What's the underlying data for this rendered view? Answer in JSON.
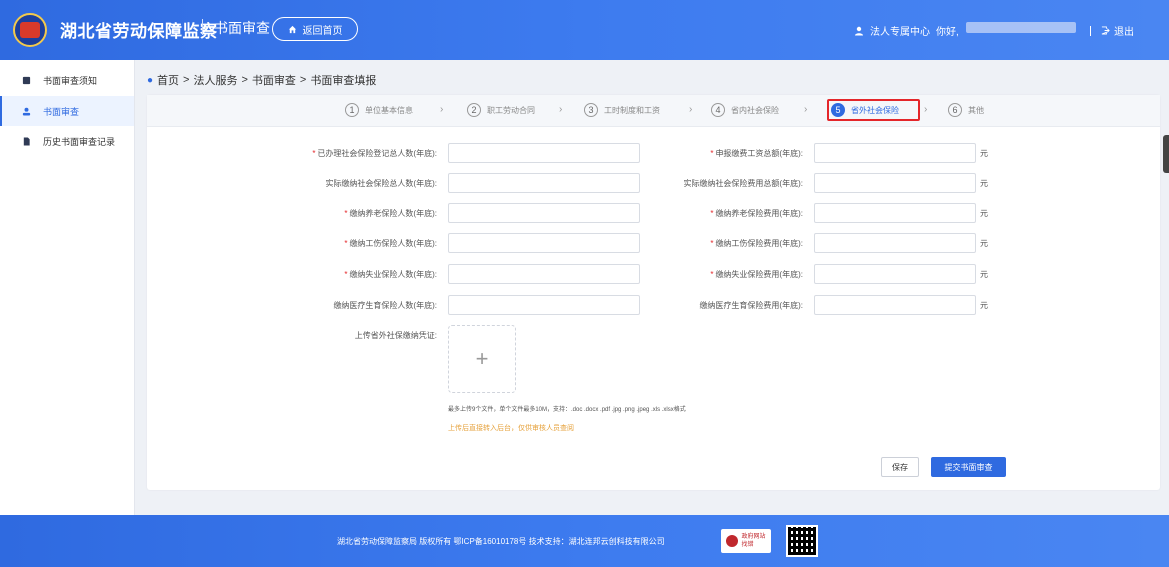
{
  "header": {
    "site_title": "湖北省劳动保障监察",
    "sub_title": "书面审查",
    "home_button": "返回首页",
    "user_center": "法人专属中心",
    "greeting": "你好,",
    "logout": "退出"
  },
  "sidebar": {
    "items": [
      {
        "label": "书面审查须知"
      },
      {
        "label": "书面审查"
      },
      {
        "label": "历史书面审查记录"
      }
    ]
  },
  "breadcrumb": [
    "首页",
    "法人服务",
    "书面审查",
    "书面审查填报"
  ],
  "breadcrumb_sep": ">",
  "steps": [
    {
      "num": "1",
      "label": "单位基本信息"
    },
    {
      "num": "2",
      "label": "职工劳动合同"
    },
    {
      "num": "3",
      "label": "工时制度和工资"
    },
    {
      "num": "4",
      "label": "省内社会保险"
    },
    {
      "num": "5",
      "label": "省外社会保险"
    },
    {
      "num": "6",
      "label": "其他"
    }
  ],
  "active_step": 5,
  "form": {
    "left": [
      {
        "label": "已办理社会保险登记总人数(年底):",
        "required": true,
        "value": ""
      },
      {
        "label": "实际缴纳社会保险总人数(年底):",
        "required": false,
        "value": ""
      },
      {
        "label": "缴纳养老保险人数(年底):",
        "required": true,
        "value": ""
      },
      {
        "label": "缴纳工伤保险人数(年底):",
        "required": true,
        "value": ""
      },
      {
        "label": "缴纳失业保险人数(年底):",
        "required": true,
        "value": ""
      },
      {
        "label": "缴纳医疗生育保险人数(年底):",
        "required": false,
        "value": ""
      }
    ],
    "right": [
      {
        "label": "申报缴费工资总额(年底):",
        "required": true,
        "value": ""
      },
      {
        "label": "实际缴纳社会保险费用总额(年底):",
        "required": false,
        "value": ""
      },
      {
        "label": "缴纳养老保险费用(年底):",
        "required": true,
        "value": ""
      },
      {
        "label": "缴纳工伤保险费用(年底):",
        "required": true,
        "value": ""
      },
      {
        "label": "缴纳失业保险费用(年底):",
        "required": true,
        "value": ""
      },
      {
        "label": "缴纳医疗生育保险费用(年底):",
        "required": false,
        "value": ""
      }
    ],
    "unit": "元",
    "required_mark": "*",
    "upload_label": "上传省外社保缴纳凭证:",
    "upload_plus": "+",
    "upload_hint": "最多上传9个文件，单个文件最多10M，支持：.doc .docx .pdf .jpg .png .jpeg .xls .xlsx格式",
    "upload_warning": "上传后直接转入后台，仅供审核人员查阅",
    "save_button": "保存",
    "submit_button": "提交书面审查"
  },
  "footer": {
    "text": "湖北省劳动保障监察局   版权所有   鄂ICP备16010178号   技术支持：湖北连邦云创科技有限公司",
    "badge_line1": "政府网站",
    "badge_line2": "找错"
  },
  "colors": {
    "primary": "#2f6ae0",
    "required": "#e4262a",
    "warning": "#e6a23c"
  }
}
